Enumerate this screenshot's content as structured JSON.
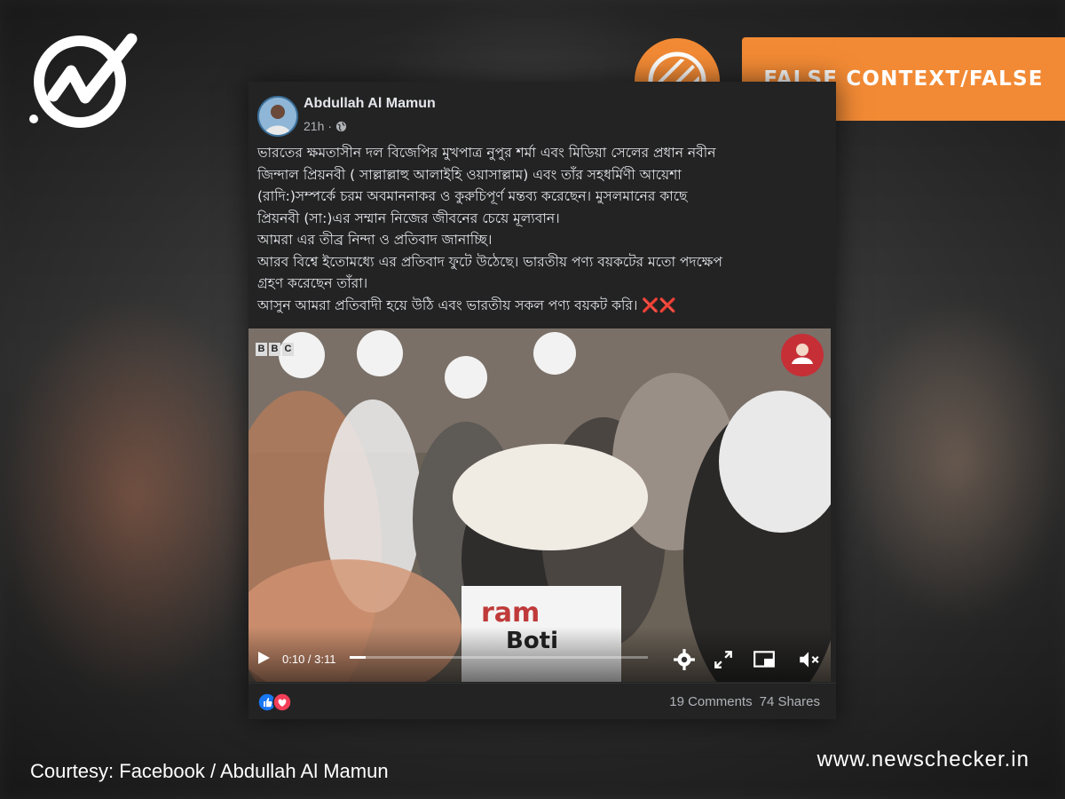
{
  "post": {
    "author": "Abdullah Al Mamun",
    "time": "21h",
    "separator": "·",
    "text_lines": [
      "ভারতের ক্ষমতাসীন দল বিজেপির মুখপাত্র নুপুর শর্মা এবং মিডিয়া সেলের প্রধান নবীন",
      "জিন্দাল প্রিয়নবী ( সাল্লাল্লাহু আলাইহি ওয়াসাল্লাম) এবং তাঁর সহধর্মিণী আয়েশা",
      "(রাদি:)সম্পর্কে চরম অবমাননাকর ও কুরুচিপূর্ণ মন্তব্য করেছেন। মুসলমানের কাছে",
      "প্রিয়নবী (সা:)এর সম্মান নিজের জীবনের চেয়ে মূল্যবান।",
      "আমরা এর তীব্র নিন্দা ও প্রতিবাদ জানাচ্ছি।",
      "আরব বিশ্বে ইতোমধ্যে এর প্রতিবাদ ফুটে উঠেছে। ভারতীয় পণ্য বয়কটের মতো পদক্ষেপ",
      "গ্রহণ করেছেন তাঁরা।",
      "আসুন আমরা প্রতিবাদী হয়ে উঠি এবং ভারতীয় সকল পণ্য বয়কট করি।"
    ],
    "emoji_suffix": "❌❌",
    "video": {
      "watermark": [
        "B",
        "B",
        "C"
      ],
      "time_display": "0:10 / 3:11",
      "progress_fraction": 0.053
    },
    "comments": "19 Comments",
    "shares": "74 Shares"
  },
  "verdict": "FALSE CONTEXT/FALSE",
  "courtesy": "Courtesy: Facebook /  Abdullah Al Mamun",
  "site": "www.newschecker.in",
  "colors": {
    "verdict_bg": "#f28a35",
    "post_bg": "#232323",
    "accent_red": "#e0245e"
  }
}
